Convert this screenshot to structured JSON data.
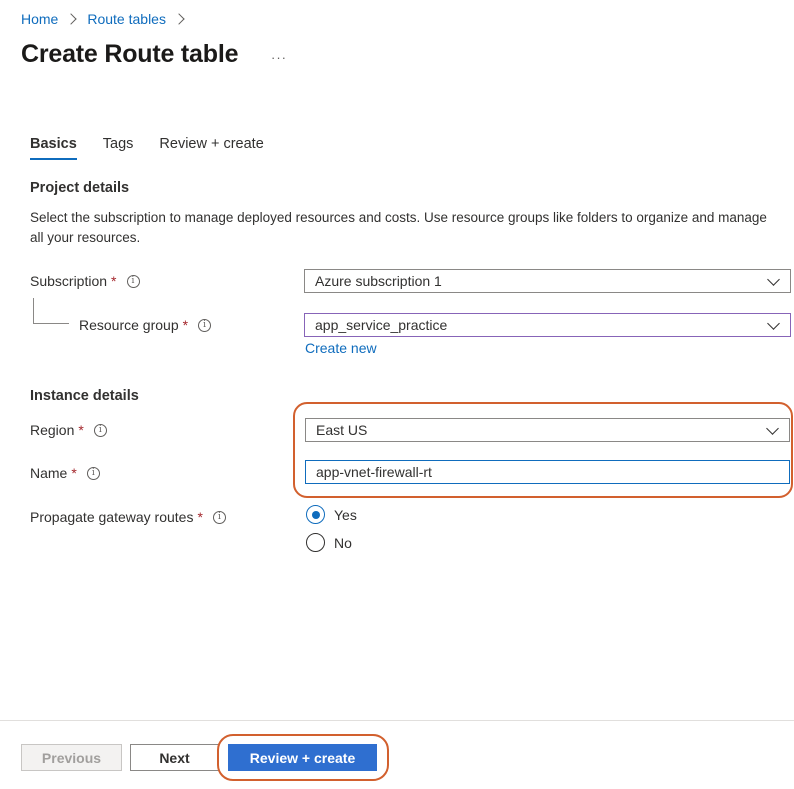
{
  "breadcrumb": {
    "home": "Home",
    "route_tables": "Route tables"
  },
  "page": {
    "title": "Create Route table",
    "more": "···"
  },
  "tabs": [
    {
      "label": "Basics",
      "active": true
    },
    {
      "label": "Tags",
      "active": false
    },
    {
      "label": "Review + create",
      "active": false
    }
  ],
  "project": {
    "heading": "Project details",
    "description": "Select the subscription to manage deployed resources and costs. Use resource groups like folders to organize and manage all your resources.",
    "subscription": {
      "label": "Subscription",
      "required": "*",
      "value": "Azure subscription 1"
    },
    "resource_group": {
      "label": "Resource group",
      "required": "*",
      "value": "app_service_practice",
      "create_new": "Create new"
    }
  },
  "instance": {
    "heading": "Instance details",
    "region": {
      "label": "Region",
      "required": "*",
      "value": "East US"
    },
    "name": {
      "label": "Name",
      "required": "*",
      "value": "app-vnet-firewall-rt"
    },
    "propagate": {
      "label": "Propagate gateway routes",
      "required": "*",
      "options": [
        "Yes",
        "No"
      ],
      "selected": "Yes"
    }
  },
  "icons": {
    "info": "info-icon",
    "chevron_down": "chevron-down-icon",
    "chevron_right": "chevron-right-icon"
  },
  "footer": {
    "previous": "Previous",
    "next": "Next",
    "review_create": "Review + create"
  },
  "colors": {
    "accent": "#0f6cbd",
    "primary_button": "#2f6fd0",
    "highlight": "#d2602e",
    "required": "#a4262c"
  }
}
